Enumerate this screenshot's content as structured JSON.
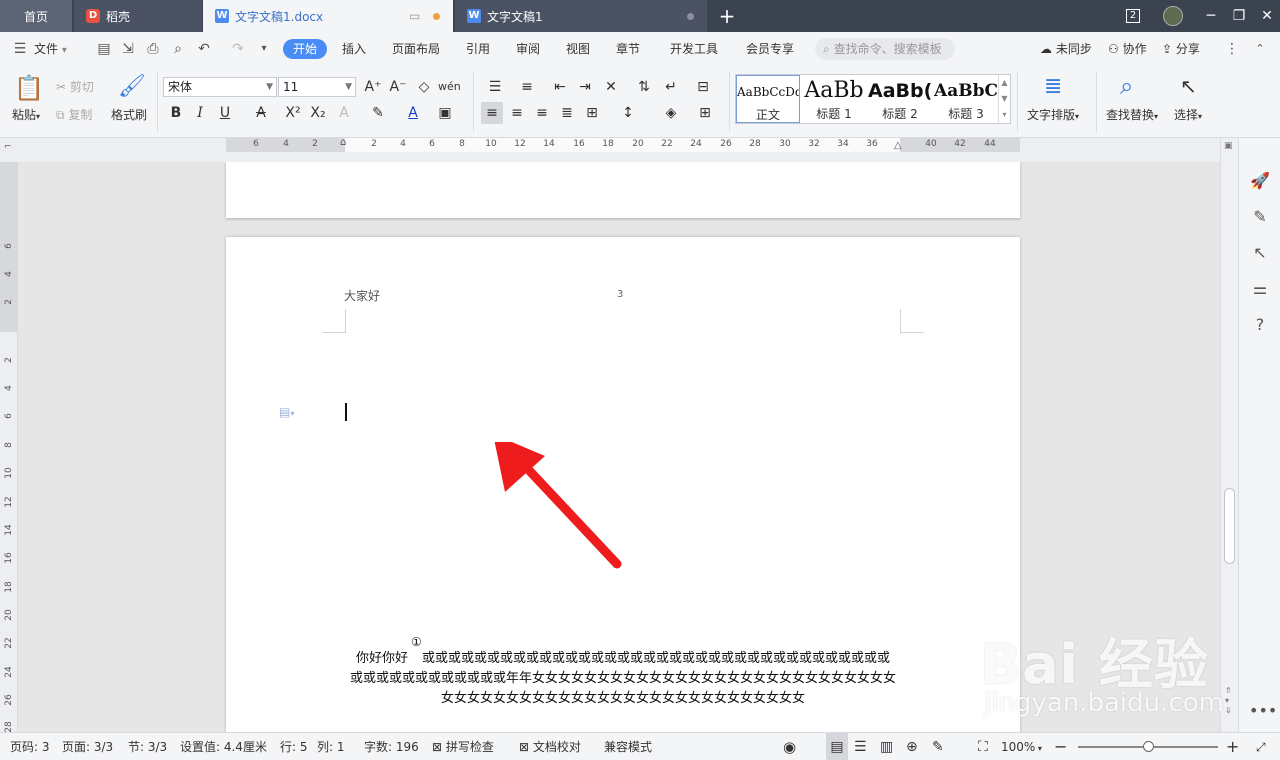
{
  "tabs": {
    "home": "首页",
    "docer": "稻壳",
    "doc1": "文字文稿1.docx",
    "doc2": "文字文稿1",
    "new_tab": "+",
    "window_count": "2"
  },
  "menu": {
    "file": "文件",
    "items": [
      "开始",
      "插入",
      "页面布局",
      "引用",
      "审阅",
      "视图",
      "章节",
      "开发工具",
      "会员专享"
    ],
    "search_placeholder": "查找命令、搜索模板",
    "sync": "未同步",
    "collab": "协作",
    "share": "分享"
  },
  "ribbon": {
    "paste": "粘贴",
    "cut": "剪切",
    "copy": "复制",
    "format_painter": "格式刷",
    "font_name": "宋体",
    "font_size": "11",
    "styles": [
      {
        "preview": "AaBbCcDd",
        "name": "正文"
      },
      {
        "preview": "AaBb",
        "name": "标题 1"
      },
      {
        "preview": "AaBb(",
        "name": "标题 2"
      },
      {
        "preview": "AaBbC(",
        "name": "标题 3"
      }
    ],
    "text_layout": "文字排版",
    "find_replace": "查找替换",
    "select": "选择"
  },
  "ruler": {
    "h_ticks": [
      "6",
      "4",
      "2",
      "2",
      "4",
      "6",
      "8",
      "10",
      "12",
      "14",
      "16",
      "18",
      "20",
      "22",
      "24",
      "26",
      "28",
      "30",
      "32",
      "34",
      "36",
      "40",
      "42",
      "44"
    ],
    "v_ticks": [
      "6",
      "4",
      "2",
      "2",
      "4",
      "6",
      "8",
      "10",
      "12",
      "14",
      "16",
      "18",
      "20",
      "22",
      "24",
      "26",
      "28"
    ]
  },
  "document": {
    "header_text": "大家好",
    "page_number": "3",
    "footnote_mark": "①",
    "body_prefix": "你好你好",
    "body_text": "或或或或或或或或或或或或或或或或或或或或或或或或或或或或或或或或或或或或或或或或或或或或或或或或年年女女女女女女女女女女女女女女女女女女女女女女女女女女女女女女女女女女女女女女女女女女女女女女女女女女女女女女女女"
  },
  "status": {
    "page": "页码: 3",
    "pages": "页面: 3/3",
    "section": "节: 3/3",
    "setting": "设置值: 4.4厘米",
    "row": "行: 5",
    "col": "列: 1",
    "words": "字数: 196",
    "spell": "拼写检查",
    "proof": "文档校对",
    "compat": "兼容模式",
    "zoom": "100%",
    "zoom_level": 0.5
  },
  "watermark": {
    "logo": "Bai 经验",
    "url": "jingyan.baidu.com"
  },
  "colors": {
    "accent": "#4a8cf5",
    "arrow": "#ee1c1c",
    "tab_bar": "#3b4250"
  }
}
